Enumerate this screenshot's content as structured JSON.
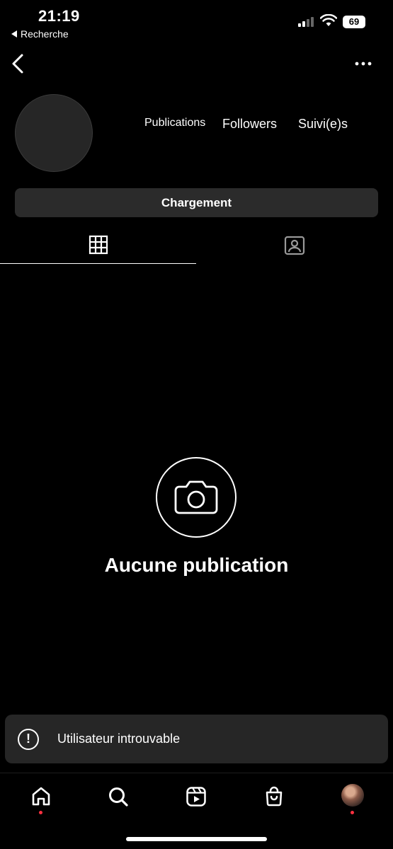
{
  "status_bar": {
    "time": "21:19",
    "back_app": "Recherche",
    "battery": "69"
  },
  "profile": {
    "stats": {
      "publications_label": "Publications",
      "followers_label": "Followers",
      "following_label": "Suivi(e)s"
    },
    "loading_button": "Chargement"
  },
  "tabs": [
    {
      "name": "grid",
      "icon": "grid-icon",
      "selected": true
    },
    {
      "name": "tagged",
      "icon": "person-tag-icon",
      "selected": false
    }
  ],
  "empty_state": {
    "icon": "camera-icon",
    "title": "Aucune publication"
  },
  "toast": {
    "icon": "exclamation-circle-icon",
    "message": "Utilisateur introuvable"
  },
  "bottom_nav": {
    "items": [
      "home-icon",
      "search-icon",
      "reels-icon",
      "shop-icon",
      "profile-avatar"
    ],
    "notification_color": "#ff3040"
  }
}
